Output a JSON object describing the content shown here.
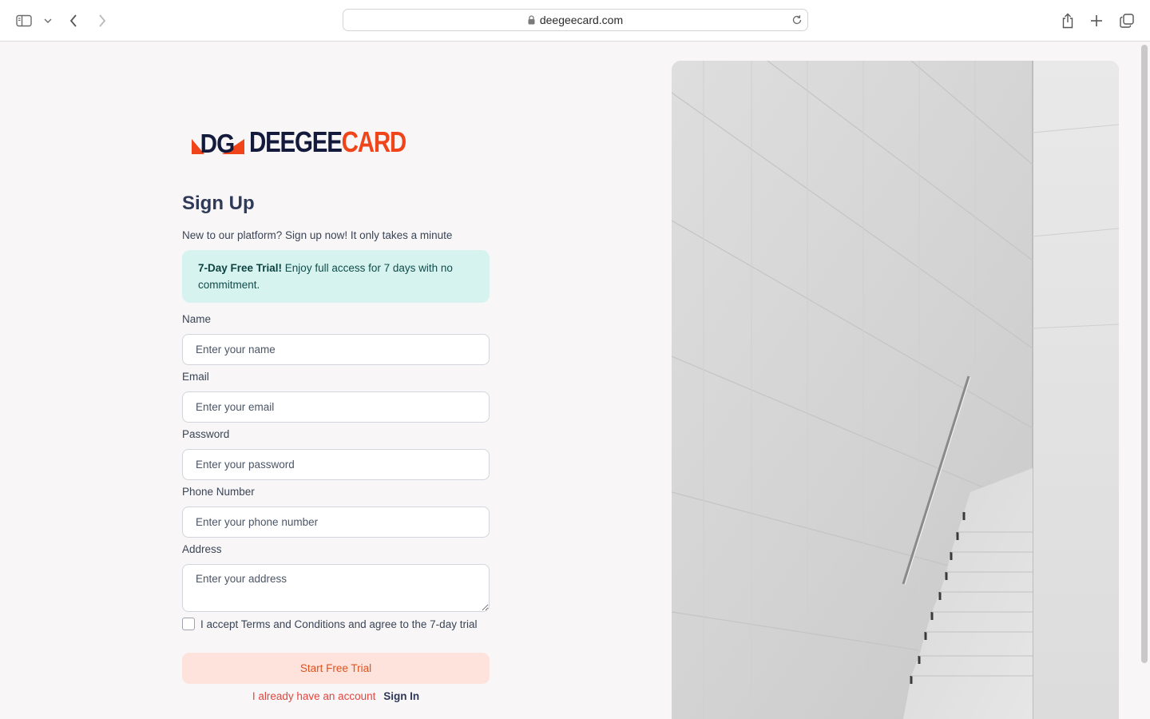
{
  "browser": {
    "url": "deegeecard.com"
  },
  "logo": {
    "mark": "DG",
    "word_dark": "DEEGEE",
    "word_orange": "CARD"
  },
  "signup": {
    "title": "Sign Up",
    "subtitle": "New to our platform? Sign up now! It only takes a minute",
    "trial_bold": "7-Day Free Trial!",
    "trial_text": " Enjoy full access for 7 days with no commitment."
  },
  "form": {
    "name_label": "Name",
    "name_placeholder": "Enter your name",
    "email_label": "Email",
    "email_placeholder": "Enter your email",
    "password_label": "Password",
    "password_placeholder": "Enter your password",
    "phone_label": "Phone Number",
    "phone_placeholder": "Enter your phone number",
    "address_label": "Address",
    "address_placeholder": "Enter your address",
    "terms_label": "I accept Terms and Conditions and agree to the 7-day trial",
    "terms_checked": false,
    "submit_label": "Start Free Trial",
    "have_account": "I already have an account",
    "sign_in": "Sign In"
  },
  "colors": {
    "brand_orange": "#f0441a",
    "brand_navy": "#141a3b",
    "trial_bg": "#d7f3f0",
    "cta_bg": "#fde3db",
    "cta_text": "#e0521f",
    "link_red": "#e0473f"
  },
  "icons": {
    "sidebar": "sidebar-icon",
    "back": "chevron-left-icon",
    "forward": "chevron-right-icon",
    "lock": "lock-icon",
    "reload": "reload-icon",
    "share": "share-icon",
    "new_tab": "plus-icon",
    "tabs": "tabs-overview-icon"
  }
}
